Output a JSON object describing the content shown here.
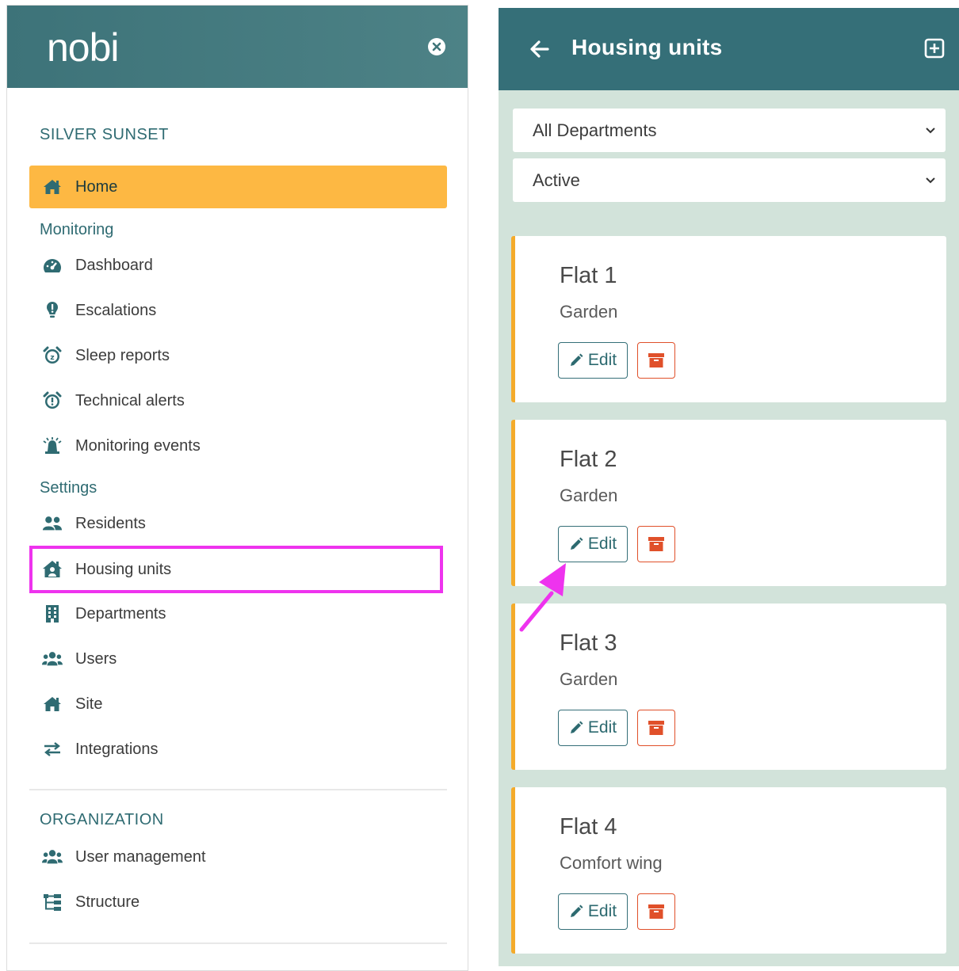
{
  "sidebar": {
    "logo": "nobi",
    "org_name": "SILVER SUNSET",
    "home": {
      "label": "Home",
      "icon": "home-icon"
    },
    "monitoring_title": "Monitoring",
    "monitoring": [
      {
        "label": "Dashboard",
        "icon": "dashboard-icon"
      },
      {
        "label": "Escalations",
        "icon": "exclamation-bulb-icon"
      },
      {
        "label": "Sleep reports",
        "icon": "alarm-clock-icon"
      },
      {
        "label": "Technical alerts",
        "icon": "alarm-clock-alert-icon"
      },
      {
        "label": "Monitoring events",
        "icon": "siren-icon"
      }
    ],
    "settings_title": "Settings",
    "settings": [
      {
        "label": "Residents",
        "icon": "people-icon"
      },
      {
        "label": "Housing units",
        "icon": "house-user-icon"
      },
      {
        "label": "Departments",
        "icon": "building-icon"
      },
      {
        "label": "Users",
        "icon": "users-icon"
      },
      {
        "label": "Site",
        "icon": "home-icon"
      },
      {
        "label": "Integrations",
        "icon": "exchange-icon"
      }
    ],
    "organization_title": "ORGANIZATION",
    "organization": [
      {
        "label": "User management",
        "icon": "users-icon"
      },
      {
        "label": "Structure",
        "icon": "sitemap-icon"
      }
    ]
  },
  "main": {
    "title": "Housing units",
    "department_filter": "All Departments",
    "status_filter": "Active",
    "cards": [
      {
        "name": "Flat 1",
        "area": "Garden",
        "edit_label": "Edit"
      },
      {
        "name": "Flat 2",
        "area": "Garden",
        "edit_label": "Edit"
      },
      {
        "name": "Flat 3",
        "area": "Garden",
        "edit_label": "Edit"
      },
      {
        "name": "Flat 4",
        "area": "Comfort wing",
        "edit_label": "Edit"
      }
    ]
  },
  "colors": {
    "header_teal": "#356f78",
    "active_orange": "#fdb843",
    "highlight_magenta": "#ee33ee",
    "archive_red": "#e0502a",
    "right_bg": "#d2e3da"
  }
}
